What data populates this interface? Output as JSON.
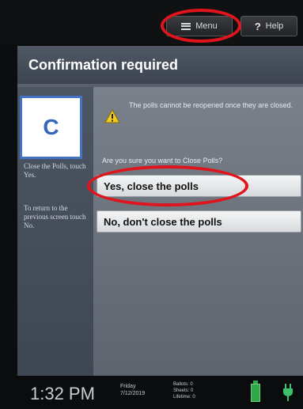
{
  "topbar": {
    "menu_label": "Menu",
    "help_label": "Help"
  },
  "header": {
    "title": "Confirmation required"
  },
  "sidebar": {
    "badge": "C",
    "instruction_1": "Close the Polls, touch Yes.",
    "instruction_2": "To return to the previous screen touch No."
  },
  "content": {
    "warning": "The polls cannot be reopened once they are closed.",
    "question": "Are you sure you want to Close Polls?",
    "yes_label": "Yes, close the polls",
    "no_label": "No, don't close the polls"
  },
  "statusbar": {
    "time": "1:32 PM",
    "day": "Friday",
    "date": "7/12/2019",
    "ballots_label": "Ballots:",
    "ballots_value": "0",
    "sheets_label": "Sheets:",
    "sheets_value": "0",
    "lifetime_label": "Lifetime:",
    "lifetime_value": "0"
  },
  "colors": {
    "annotation_red": "#e0141c",
    "badge_blue": "#4472c4",
    "battery_green": "#2fa84a"
  },
  "icons": {
    "menu": "hamburger-icon",
    "help": "question-icon",
    "warning": "warning-icon",
    "battery": "battery-icon",
    "power": "plug-icon"
  }
}
